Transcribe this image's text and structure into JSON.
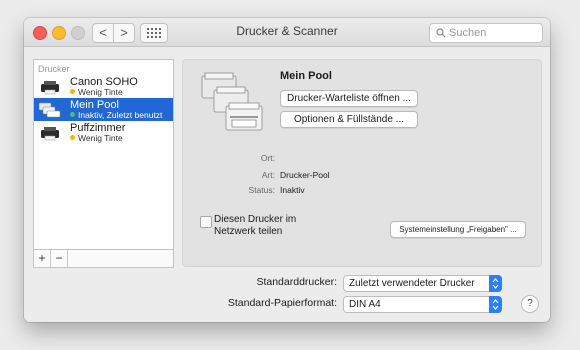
{
  "window": {
    "title": "Drucker & Scanner",
    "search_placeholder": "Suchen"
  },
  "toolbar": {
    "back_glyph": "<",
    "forward_glyph": ">",
    "grid_glyph": "⁙⁙⁙"
  },
  "sidebar": {
    "header": "Drucker",
    "printers": [
      {
        "name": "Canon SOHO",
        "status": "Wenig Tinte",
        "status_color": "#f2b800",
        "selected": false
      },
      {
        "name": "Mein Pool",
        "status": "Inaktiv, Zuletzt benutzt",
        "status_color": "#47c26b",
        "selected": true
      },
      {
        "name": "Puffzimmer",
        "status": "Wenig Tinte",
        "status_color": "#f2b800",
        "selected": false
      }
    ],
    "add_label": "+",
    "remove_label": "−"
  },
  "detail": {
    "printer_name": "Mein Pool",
    "queue_button": "Drucker-Warteliste öffnen ...",
    "options_button": "Optionen & Füllstände ...",
    "fields": [
      {
        "key": "Ort:",
        "value": ""
      },
      {
        "key": "Art:",
        "value": "Drucker-Pool"
      },
      {
        "key": "Status:",
        "value": "Inaktiv"
      }
    ],
    "share_checkbox_label": "Diesen Drucker im Netzwerk teilen",
    "share_checked": false,
    "sharing_prefs_button": "Systemeinstellung „Freigaben\" ..."
  },
  "defaults": {
    "default_printer_label": "Standarddrucker:",
    "default_printer_value": "Zuletzt verwendeter Drucker",
    "paper_label": "Standard-Papierformat:",
    "paper_value": "DIN A4"
  },
  "help_label": "?",
  "colors": {
    "selection": "#2367d4",
    "popup_accent": "#2d7ff5"
  }
}
